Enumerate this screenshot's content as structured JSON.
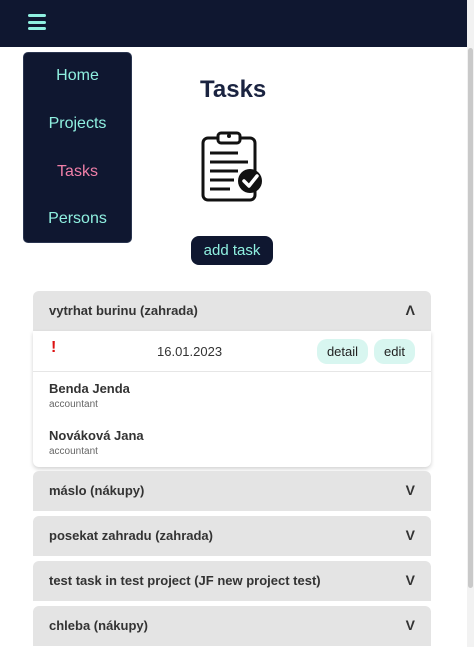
{
  "nav": {
    "menu_icon": "hamburger-icon",
    "items": [
      {
        "label": "Home",
        "active": false
      },
      {
        "label": "Projects",
        "active": false
      },
      {
        "label": "Tasks",
        "active": true
      },
      {
        "label": "Persons",
        "active": false
      }
    ]
  },
  "page": {
    "title": "Tasks",
    "icon": "clipboard-check-icon",
    "add_button": "add task"
  },
  "tasks": [
    {
      "title": "vytrhat burinu (zahrada)",
      "chevron": "Λ",
      "expanded": true,
      "priority_mark": "!",
      "date": "16.01.2023",
      "detail_label": "detail",
      "edit_label": "edit",
      "persons": [
        {
          "name": "Benda Jenda",
          "role": "accountant"
        },
        {
          "name": "Nováková Jana",
          "role": "accountant"
        }
      ]
    },
    {
      "title": "máslo (nákupy)",
      "chevron": "V",
      "expanded": false
    },
    {
      "title": "posekat zahradu (zahrada)",
      "chevron": "V",
      "expanded": false
    },
    {
      "title": "test task in test project (JF new project test)",
      "chevron": "V",
      "expanded": false
    },
    {
      "title": "chleba (nákupy)",
      "chevron": "V",
      "expanded": false
    }
  ],
  "colors": {
    "navy": "#0f1730",
    "accent": "#8ff0e0",
    "active": "#f07fa8",
    "pill": "#d8f6f0",
    "priority": "#dd1111"
  }
}
